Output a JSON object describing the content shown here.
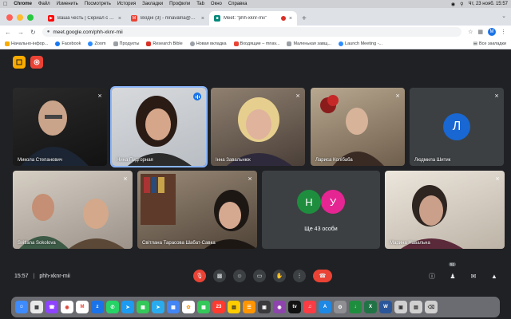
{
  "menubar": {
    "app": "Chrome",
    "items": [
      "Файл",
      "Изменить",
      "Посмотреть",
      "История",
      "Закладки",
      "Профили",
      "Tab",
      "Окно",
      "Справка"
    ],
    "clock": "Чт, 23 нояб.  15:57"
  },
  "tabs": [
    {
      "title": "Ваша честь | Сериал с Олег...",
      "color": "#ff0000"
    },
    {
      "title": "Вхідні (3) - mnavalna@gmail...",
      "color": "#ea4335"
    },
    {
      "title": "Meet: \"phh-xknr-mii\"",
      "color": "#00897b",
      "active": true
    }
  ],
  "address": {
    "url": "meet.google.com/phh-xknr-mii",
    "profile_letter": "M"
  },
  "bookmarks": {
    "items": [
      {
        "label": "Начально-інфор...",
        "color": "#f9ab00"
      },
      {
        "label": "Facebook",
        "color": "#1877f2"
      },
      {
        "label": "Zoom",
        "color": "#2d8cff"
      },
      {
        "label": "Продукты",
        "color": "#5f6368"
      },
      {
        "label": "Research Bible",
        "color": "#d93025"
      },
      {
        "label": "Новая вкладка",
        "color": "#5f6368"
      },
      {
        "label": "Входящие – mnav...",
        "color": "#ea4335"
      },
      {
        "label": "Маленькая завщ...",
        "color": "#5f6368"
      },
      {
        "label": "Launch Meeting -...",
        "color": "#2d8cff"
      }
    ],
    "all_label": "Все закладки"
  },
  "participants": [
    {
      "name": "Микола Степанович",
      "muted": true
    },
    {
      "name": "Нина Пидгорная",
      "speaking": true
    },
    {
      "name": "Інна Завальнюк",
      "muted": true
    },
    {
      "name": "Лариса Колібаба",
      "muted": true
    },
    {
      "name": "Людмила Шитик",
      "muted": true,
      "initial": "Л",
      "avatar_color": "#1967d2"
    },
    {
      "name": "Svitlana Sokolova",
      "muted": true
    },
    {
      "name": "Світлана Тарасова Шабат-Савка",
      "muted": true
    },
    {
      "name": "Марина Навальна",
      "muted": true
    }
  ],
  "others": {
    "label": "Ще 43 особи",
    "initials": [
      "Н",
      "У"
    ],
    "colors": [
      "#1e8e3e",
      "#e52592"
    ]
  },
  "bottom": {
    "time": "15:57",
    "meeting_code": "phh-xknr-mii",
    "participants_count": "51"
  },
  "icons": {
    "mic_off": "mic-off-icon",
    "camera": "camera-icon",
    "emoji": "emoji-icon",
    "present": "present-icon",
    "hand": "raise-hand-icon",
    "more": "more-icon",
    "end": "end-call-icon",
    "info": "info-icon",
    "people": "people-icon",
    "chat": "chat-icon",
    "activities": "activities-icon"
  }
}
